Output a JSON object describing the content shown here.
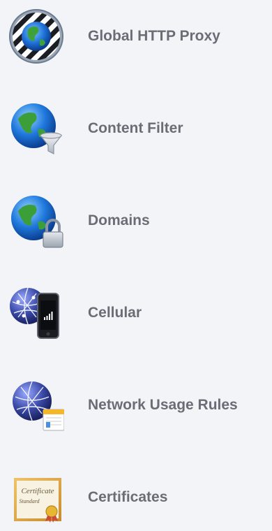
{
  "items": [
    {
      "label": "Global HTTP Proxy",
      "icon": "globe-proxy-icon"
    },
    {
      "label": "Content Filter",
      "icon": "globe-filter-icon"
    },
    {
      "label": "Domains",
      "icon": "globe-lock-icon"
    },
    {
      "label": "Cellular",
      "icon": "cellular-phone-icon"
    },
    {
      "label": "Network Usage Rules",
      "icon": "network-usage-icon"
    },
    {
      "label": "Certificates",
      "icon": "certificate-icon"
    }
  ],
  "certificate_text": {
    "line1": "Certificate",
    "line2": "Standard"
  }
}
